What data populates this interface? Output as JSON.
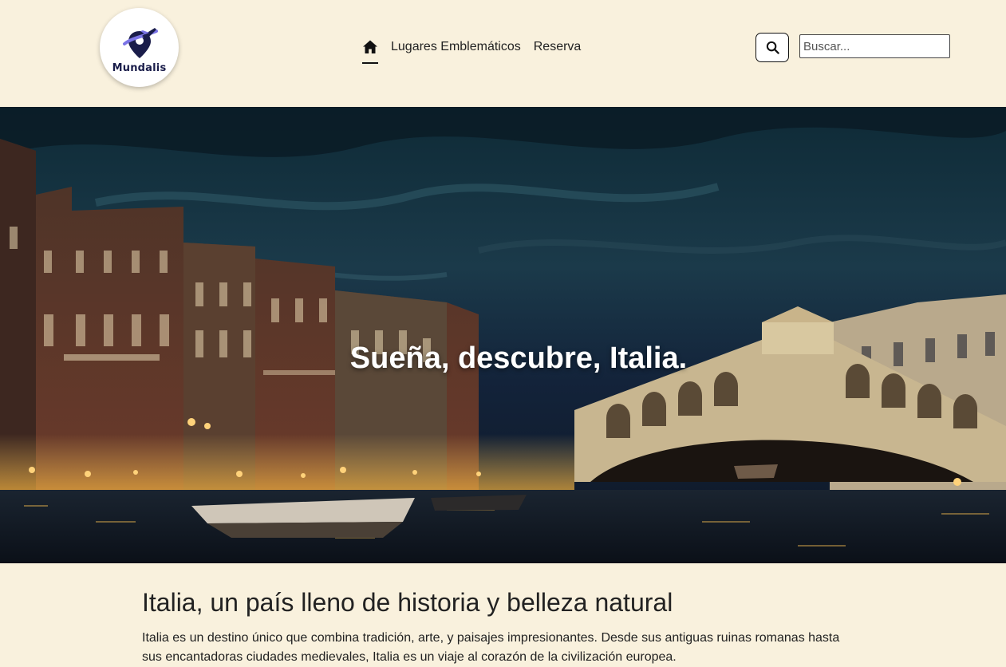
{
  "brand": {
    "name": "Mundalis"
  },
  "nav": {
    "home_icon": "home-icon",
    "items": [
      {
        "label": "Lugares Emblemáticos"
      },
      {
        "label": "Reserva"
      }
    ]
  },
  "search": {
    "button_icon": "search-icon",
    "placeholder": "Buscar...",
    "value": ""
  },
  "hero": {
    "title": "Sueña, descubre, Italia."
  },
  "intro": {
    "heading": "Italia, un país lleno de historia y belleza natural",
    "text": "Italia es un destino único que combina tradición, arte, y paisajes impresionantes. Desde sus antiguas ruinas romanas hasta sus encantadoras ciudades medievales, Italia es un viaje al corazón de la civilización europea."
  },
  "colors": {
    "background": "#f9f1dd",
    "text": "#222222",
    "brand_navy": "#1a1d4a",
    "brand_purple": "#7b74e6"
  }
}
